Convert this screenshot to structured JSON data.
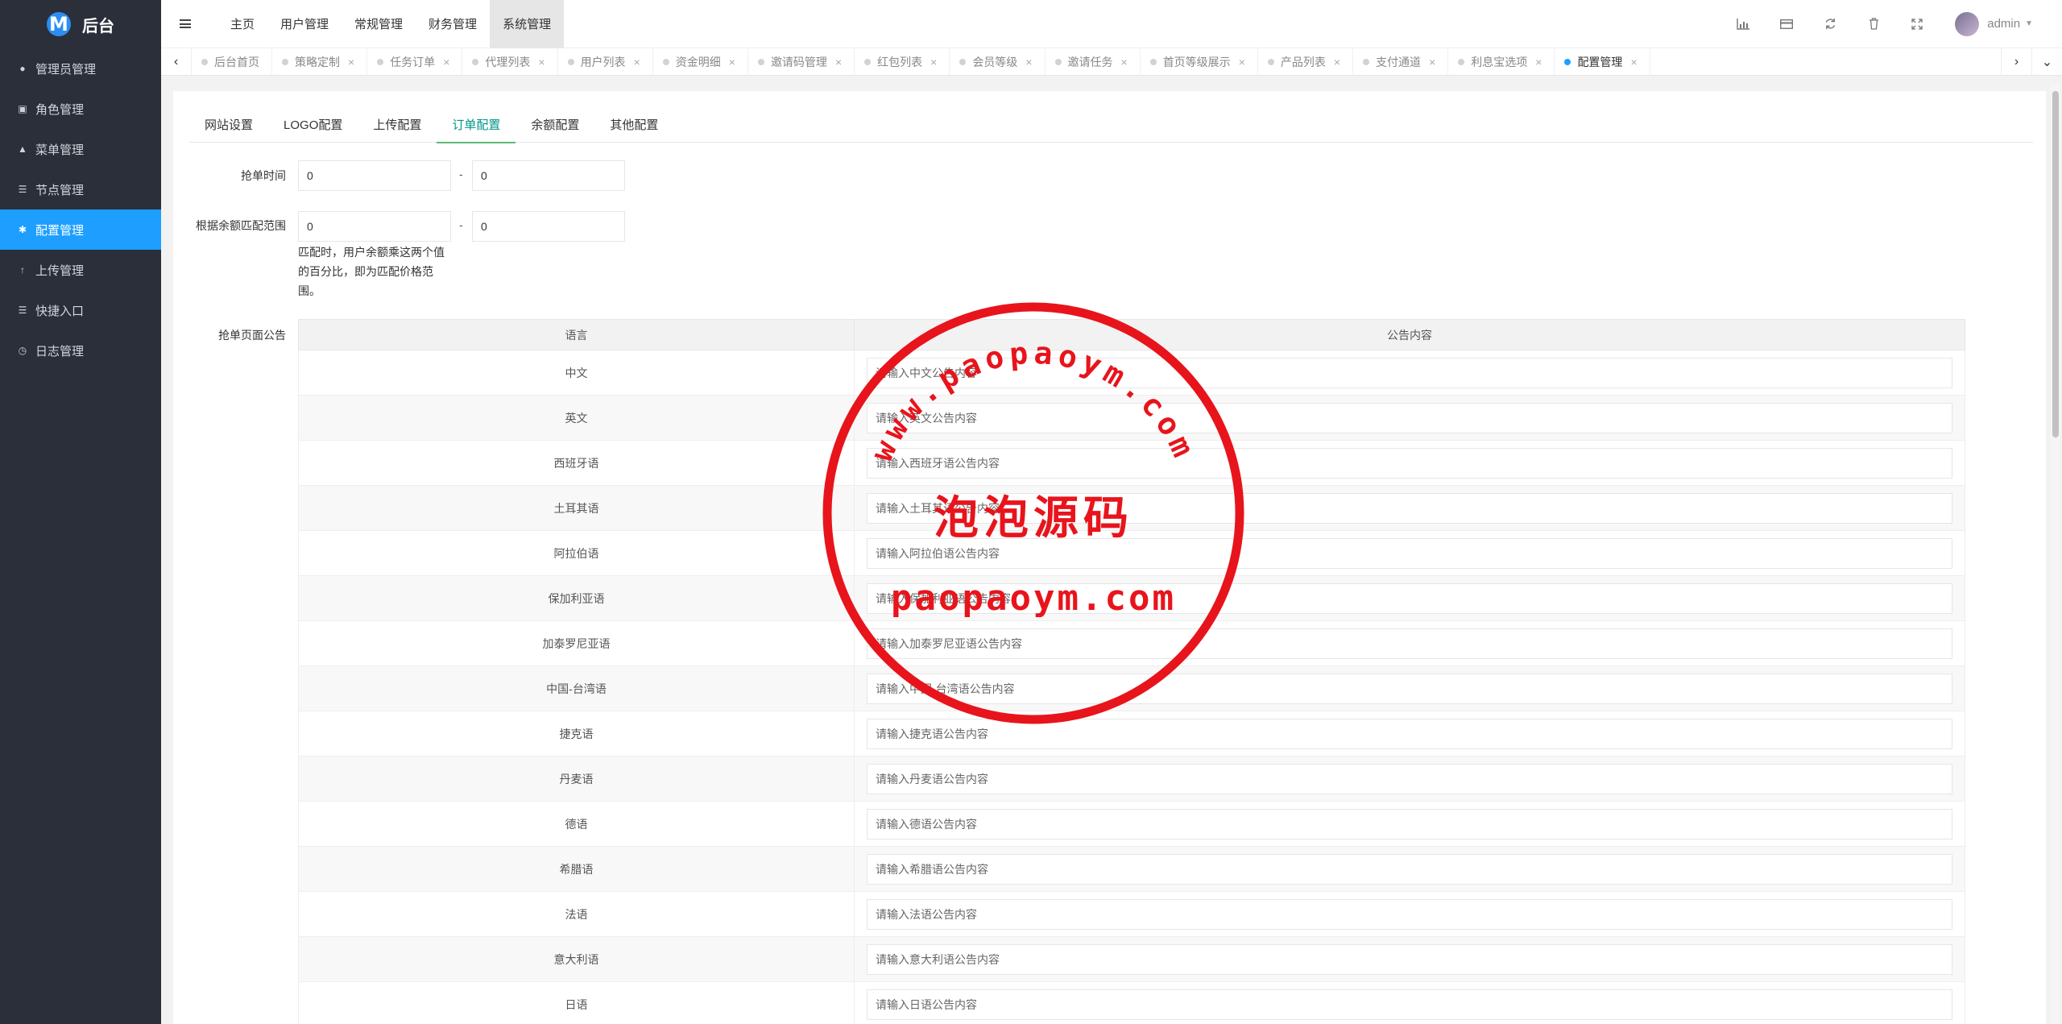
{
  "app": {
    "logo_letter": "M",
    "title": "后台"
  },
  "sidebar": {
    "items": [
      {
        "label": "管理员管理",
        "icon": "user-icon"
      },
      {
        "label": "角色管理",
        "icon": "id-card-icon"
      },
      {
        "label": "菜单管理",
        "icon": "bell-icon"
      },
      {
        "label": "节点管理",
        "icon": "list-icon"
      },
      {
        "label": "配置管理",
        "icon": "gear-icon",
        "active": true
      },
      {
        "label": "上传管理",
        "icon": "upload-arrow-icon"
      },
      {
        "label": "快捷入口",
        "icon": "list-icon"
      },
      {
        "label": "日志管理",
        "icon": "clock-icon"
      }
    ]
  },
  "topnav": {
    "items": [
      {
        "label": "主页"
      },
      {
        "label": "用户管理"
      },
      {
        "label": "常规管理"
      },
      {
        "label": "财务管理"
      },
      {
        "label": "系统管理",
        "active": true
      }
    ]
  },
  "header": {
    "username": "admin"
  },
  "page_tabs": [
    {
      "label": "后台首页",
      "closable": false
    },
    {
      "label": "策略定制",
      "closable": true
    },
    {
      "label": "任务订单",
      "closable": true
    },
    {
      "label": "代理列表",
      "closable": true
    },
    {
      "label": "用户列表",
      "closable": true
    },
    {
      "label": "资金明细",
      "closable": true
    },
    {
      "label": "邀请码管理",
      "closable": true
    },
    {
      "label": "红包列表",
      "closable": true
    },
    {
      "label": "会员等级",
      "closable": true
    },
    {
      "label": "邀请任务",
      "closable": true
    },
    {
      "label": "首页等级展示",
      "closable": true
    },
    {
      "label": "产品列表",
      "closable": true
    },
    {
      "label": "支付通道",
      "closable": true
    },
    {
      "label": "利息宝选项",
      "closable": true
    },
    {
      "label": "配置管理",
      "closable": true,
      "active": true
    }
  ],
  "subtabs": [
    {
      "label": "网站设置"
    },
    {
      "label": "LOGO配置"
    },
    {
      "label": "上传配置"
    },
    {
      "label": "订单配置",
      "active": true
    },
    {
      "label": "余额配置"
    },
    {
      "label": "其他配置"
    }
  ],
  "form": {
    "grab_time": {
      "label": "抢单时间",
      "from": "0",
      "to": "0",
      "separator": "-"
    },
    "balance_range": {
      "label": "根据余额匹配范围",
      "from": "0",
      "to": "0",
      "separator": "-",
      "tip": "匹配时，用户余额乘这两个值的百分比，即为匹配价格范围。"
    },
    "notice": {
      "label": "抢单页面公告"
    }
  },
  "notice_table": {
    "columns": [
      "语言",
      "公告内容"
    ],
    "rows": [
      {
        "lang": "中文",
        "placeholder": "请输入中文公告内容"
      },
      {
        "lang": "英文",
        "placeholder": "请输入英文公告内容"
      },
      {
        "lang": "西班牙语",
        "placeholder": "请输入西班牙语公告内容"
      },
      {
        "lang": "土耳其语",
        "placeholder": "请输入土耳其语公告内容"
      },
      {
        "lang": "阿拉伯语",
        "placeholder": "请输入阿拉伯语公告内容"
      },
      {
        "lang": "保加利亚语",
        "placeholder": "请输入保加利亚语公告内容"
      },
      {
        "lang": "加泰罗尼亚语",
        "placeholder": "请输入加泰罗尼亚语公告内容"
      },
      {
        "lang": "中国-台湾语",
        "placeholder": "请输入中国-台湾语公告内容"
      },
      {
        "lang": "捷克语",
        "placeholder": "请输入捷克语公告内容"
      },
      {
        "lang": "丹麦语",
        "placeholder": "请输入丹麦语公告内容"
      },
      {
        "lang": "德语",
        "placeholder": "请输入德语公告内容"
      },
      {
        "lang": "希腊语",
        "placeholder": "请输入希腊语公告内容"
      },
      {
        "lang": "法语",
        "placeholder": "请输入法语公告内容"
      },
      {
        "lang": "意大利语",
        "placeholder": "请输入意大利语公告内容"
      },
      {
        "lang": "日语",
        "placeholder": "请输入日语公告内容"
      }
    ]
  },
  "watermark": {
    "arc_text": "www.paopaoym.com",
    "center_text": "泡泡源码",
    "bottom_text": "paopaoym.com",
    "color": "#e8141c"
  },
  "colors": {
    "sidebar_bg": "#2a2f3a",
    "accent": "#1e9fff",
    "subtab_active": "#009688"
  }
}
